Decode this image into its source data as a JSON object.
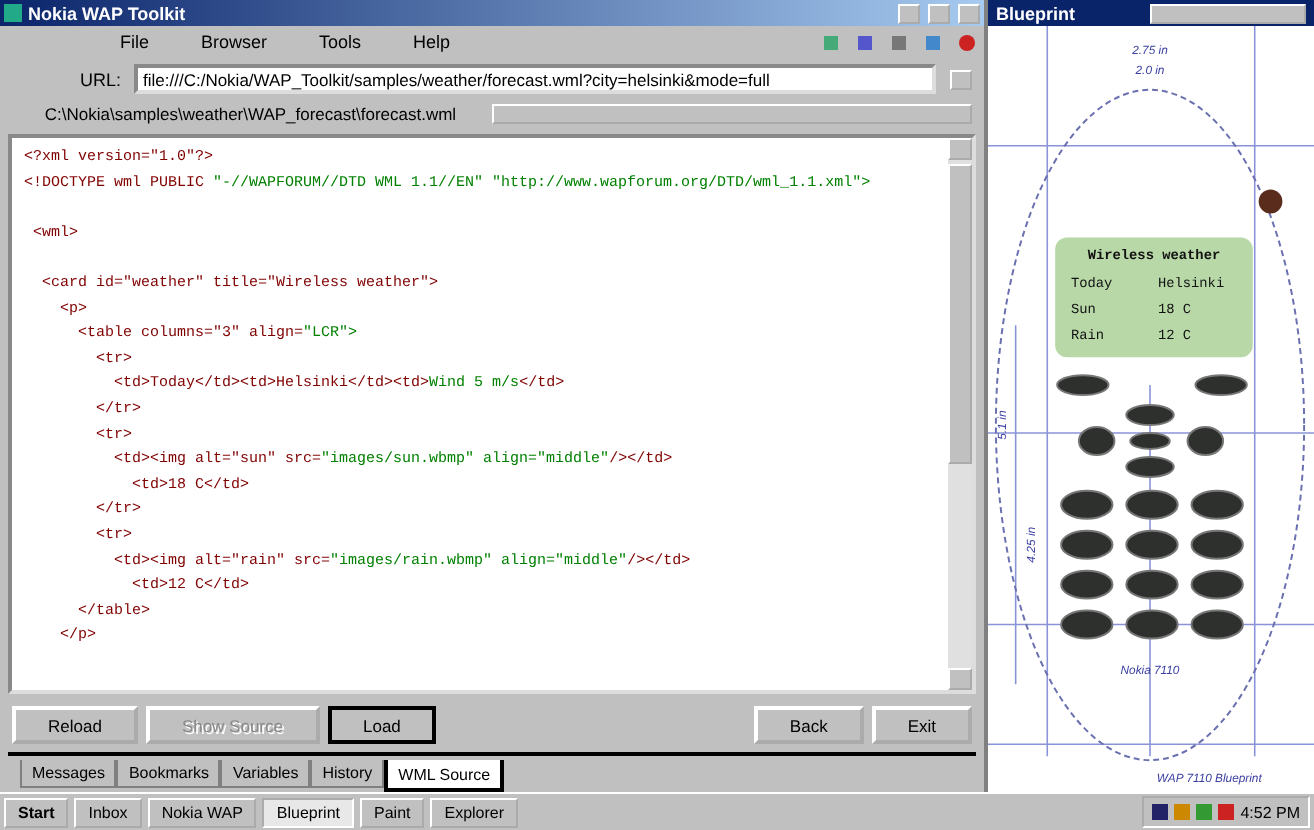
{
  "window": {
    "title": "Nokia WAP Toolkit"
  },
  "menu": [
    {
      "label": "File"
    },
    {
      "label": "Browser"
    },
    {
      "label": "Tools"
    },
    {
      "label": "Help"
    }
  ],
  "location": {
    "label": "URL:",
    "value": "file:///C:/Nokia/WAP_Toolkit/samples/weather/forecast.wml?city=helsinki&mode=full"
  },
  "document_title": "C:\\Nokia\\samples\\weather\\WAP_forecast\\forecast.wml",
  "code_lines": [
    [
      {
        "kind": "tag",
        "text": "<?xml version=\"1.0\"?>"
      }
    ],
    [
      {
        "kind": "tag",
        "text": "<!DOCTYPE wml PUBLIC "
      },
      {
        "kind": "value",
        "text": "\"-//WAPFORUM//DTD WML 1.1//EN\" \"http://www.wapforum.org/DTD/wml_1.1.xml\">"
      }
    ],
    {
      "blank_before": true,
      "segments": [
        {
          "kind": "tag",
          "text": " <wml>"
        }
      ]
    },
    {
      "blank_before": true,
      "segments": [
        {
          "kind": "tag",
          "text": "  <card id=\"weather\" title=\"Wireless weather\">"
        }
      ]
    },
    [
      {
        "kind": "tag",
        "text": "    <p>"
      }
    ],
    [
      {
        "kind": "tag",
        "text": "      <table columns=\"3\" align="
      },
      {
        "kind": "value",
        "text": "\"LCR\">"
      }
    ],
    [
      {
        "kind": "tag",
        "text": "        <tr>"
      }
    ],
    [
      {
        "kind": "tag",
        "text": "          <td>Today</td><td>Helsinki</td><td>"
      },
      {
        "kind": "value",
        "text": "Wind 5 m/s"
      },
      {
        "kind": "tag",
        "text": "</td>"
      }
    ],
    [
      {
        "kind": "tag",
        "text": "        </tr>"
      }
    ],
    [
      {
        "kind": "tag",
        "text": "        <tr>"
      }
    ],
    [
      {
        "kind": "tag",
        "text": "          <td><img alt=\"sun\" src="
      },
      {
        "kind": "value",
        "text": "\"images/sun.wbmp\" align=\"middle\""
      },
      {
        "kind": "tag",
        "text": "/></td>"
      }
    ],
    [
      {
        "kind": "tag",
        "text": "            <td>18 C</td>"
      }
    ],
    [
      {
        "kind": "tag",
        "text": "        </tr>"
      }
    ],
    [
      {
        "kind": "tag",
        "text": "        <tr>"
      }
    ],
    [
      {
        "kind": "tag",
        "text": "          <td><img alt=\"rain\" src="
      },
      {
        "kind": "value",
        "text": "\"images/rain.wbmp\" align=\"middle\""
      },
      {
        "kind": "tag",
        "text": "/></td>"
      }
    ],
    [
      {
        "kind": "tag",
        "text": "            <td>12 C</td>"
      }
    ],
    [
      {
        "kind": "tag",
        "text": "      </table>"
      }
    ],
    [
      {
        "kind": "tag",
        "text": "    </p>"
      }
    ]
  ],
  "buttons": [
    {
      "label": "Reload",
      "disabled": false
    },
    {
      "label": "Show Source",
      "disabled": true
    },
    {
      "label": "Load",
      "disabled": false
    }
  ],
  "right_buttons": [
    {
      "label": "Back"
    },
    {
      "label": "Exit"
    }
  ],
  "tabs": [
    {
      "label": "Messages",
      "selected": false
    },
    {
      "label": "Bookmarks",
      "selected": false
    },
    {
      "label": "Variables",
      "selected": false
    },
    {
      "label": "History",
      "selected": false
    },
    {
      "label": "WML Source",
      "selected": true
    }
  ],
  "phone": {
    "title": "Blueprint",
    "dims": [
      "2.75 in",
      "2.0 in",
      "5.1 in",
      "4.25 in"
    ],
    "model_label": "Nokia 7110",
    "footer": "WAP 7110 Blueprint",
    "screen": {
      "title": "Wireless weather",
      "rows": [
        [
          "Today",
          "Helsinki"
        ],
        [
          "Sun",
          "18 C"
        ],
        [
          "Rain",
          "12 C"
        ]
      ]
    }
  },
  "taskbar": [
    {
      "label": "Start"
    },
    {
      "label": "Inbox"
    },
    {
      "label": "Nokia WAP"
    },
    {
      "label": "Blueprint",
      "selected": true
    },
    {
      "label": "Paint"
    },
    {
      "label": "Explorer"
    }
  ],
  "clock": "4:52 PM"
}
